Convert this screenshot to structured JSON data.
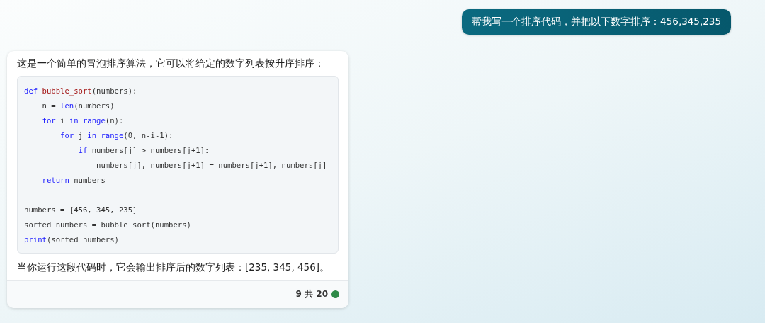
{
  "user_message": {
    "text": "帮我写一个排序代码，并把以下数字排序：456,345,235"
  },
  "reply": {
    "intro": "这是一个简单的冒泡排序算法，它可以将给定的数字列表按升序排序：",
    "code_lines": [
      {
        "kind": "code",
        "tokens": [
          {
            "kind": "keyword",
            "text": "def "
          },
          {
            "kind": "name",
            "text": "bubble_sort"
          },
          {
            "kind": "plain",
            "text": "(numbers):"
          }
        ],
        "children": [
          {
            "kind": "code",
            "tokens": [
              {
                "kind": "plain",
                "text": "n = "
              },
              {
                "kind": "keyword",
                "text": "len"
              },
              {
                "kind": "plain",
                "text": "(numbers)"
              }
            ]
          },
          {
            "kind": "code",
            "tokens": [
              {
                "kind": "keyword",
                "text": "for"
              },
              {
                "kind": "plain",
                "text": " i "
              },
              {
                "kind": "keyword",
                "text": "in range"
              },
              {
                "kind": "plain",
                "text": "(n):"
              }
            ],
            "children": [
              {
                "kind": "code",
                "tokens": [
                  {
                    "kind": "keyword",
                    "text": "for"
                  },
                  {
                    "kind": "plain",
                    "text": " j "
                  },
                  {
                    "kind": "keyword",
                    "text": "in range"
                  },
                  {
                    "kind": "plain",
                    "text": "(0, n-i-1):"
                  }
                ],
                "children": [
                  {
                    "kind": "code",
                    "tokens": [
                      {
                        "kind": "keyword",
                        "text": "if"
                      },
                      {
                        "kind": "plain",
                        "text": " numbers[j] > numbers[j+1]:"
                      }
                    ],
                    "children": [
                      {
                        "kind": "code",
                        "tokens": [
                          {
                            "kind": "plain",
                            "text": "numbers[j], numbers[j+1] = numbers[j+1], numbers[j]"
                          }
                        ]
                      }
                    ]
                  }
                ]
              }
            ]
          },
          {
            "kind": "code",
            "tokens": [
              {
                "kind": "keyword",
                "text": "return"
              },
              {
                "kind": "plain",
                "text": " numbers"
              }
            ]
          }
        ]
      },
      {
        "kind": "blank"
      },
      {
        "kind": "code",
        "tokens": [
          {
            "kind": "plain",
            "text": "numbers = [456, 345, 235]"
          }
        ]
      },
      {
        "kind": "code",
        "tokens": [
          {
            "kind": "plain",
            "text": "sorted_numbers = bubble_sort(numbers)"
          }
        ]
      },
      {
        "kind": "code",
        "tokens": [
          {
            "kind": "keyword",
            "text": "print"
          },
          {
            "kind": "plain",
            "text": "(sorted_numbers)"
          }
        ]
      }
    ],
    "outro": "当你运行这段代码时，它会输出排序后的数字列表：[235, 345, 456]。",
    "footer": {
      "count": "9 共 20"
    }
  }
}
